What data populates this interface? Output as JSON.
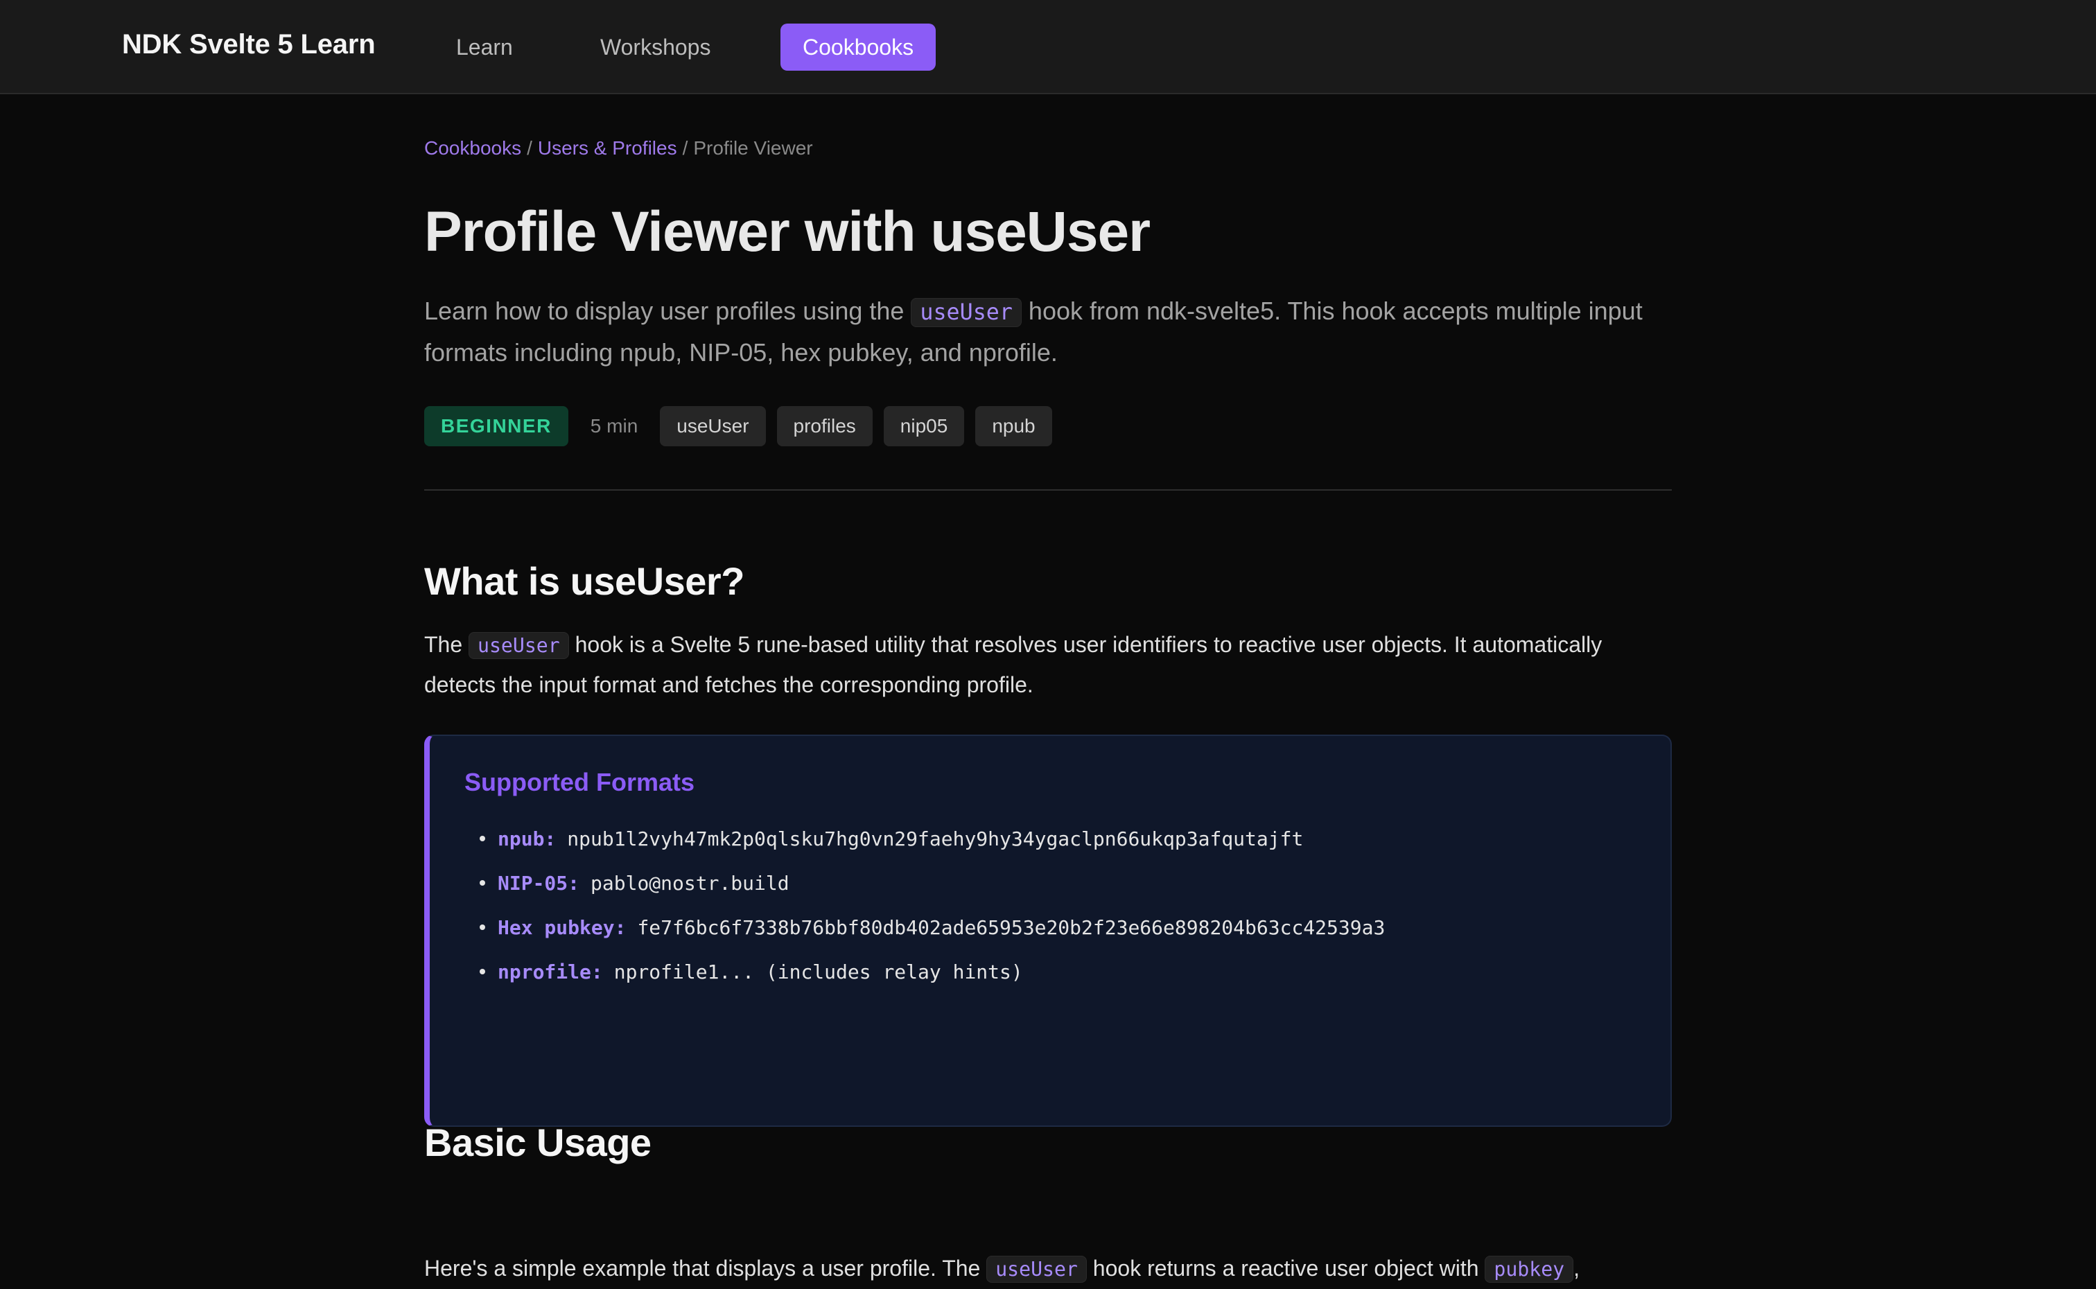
{
  "nav": {
    "brand": "NDK Svelte 5 Learn",
    "links": [
      {
        "label": "Learn"
      },
      {
        "label": "Workshops"
      },
      {
        "label": "Cookbooks",
        "active": true
      }
    ]
  },
  "breadcrumb": {
    "items": [
      "Cookbooks",
      "Users & Profiles"
    ],
    "separator": "/",
    "current": "Profile Viewer"
  },
  "page": {
    "title": "Profile Viewer with useUser",
    "lead_before": "Learn how to display user profiles using the",
    "lead_code": "useUser",
    "lead_after": "hook from ndk-svelte5. This hook accepts multiple input formats including npub, NIP-05, hex pubkey, and nprofile."
  },
  "meta": {
    "level": "BEGINNER",
    "duration": "5 min",
    "tags": [
      "useUser",
      "profiles",
      "nip05",
      "npub"
    ]
  },
  "section1": {
    "title": "What is useUser?",
    "text_before": "The",
    "text_code": "useUser",
    "text_after": "hook is a Svelte 5 rune-based utility that resolves user identifiers to reactive user objects. It automatically detects the input format and fetches the corresponding profile."
  },
  "callout": {
    "title": "Supported Formats",
    "items": [
      {
        "label": "npub:",
        "value": "npub1l2vyh47mk2p0qlsku7hg0vn29faehy9hy34ygaclpn66ukqp3afqutajft"
      },
      {
        "label": "NIP-05:",
        "value": "pablo@nostr.build"
      },
      {
        "label": "Hex pubkey:",
        "value": "fe7f6bc6f7338b76bbf80db402ade65953e20b2f23e66e898204b63cc42539a3"
      },
      {
        "label": "nprofile:",
        "value": "nprofile1... (includes relay hints)"
      }
    ]
  },
  "section2": {
    "title": "Basic Usage",
    "text_before": "Here's a simple example that displays a user profile. The",
    "text_code": "useUser",
    "text_middle": "hook returns a reactive user object with",
    "text_code2": "pubkey",
    "text_after": ","
  },
  "colors": {
    "accent": "#8b5cf6",
    "background": "#0a0a0a",
    "topbar": "#1a1a1a",
    "callout_bg": "#0f172a",
    "level_badge_bg": "#0d3b2a",
    "level_badge_text": "#34d399"
  }
}
